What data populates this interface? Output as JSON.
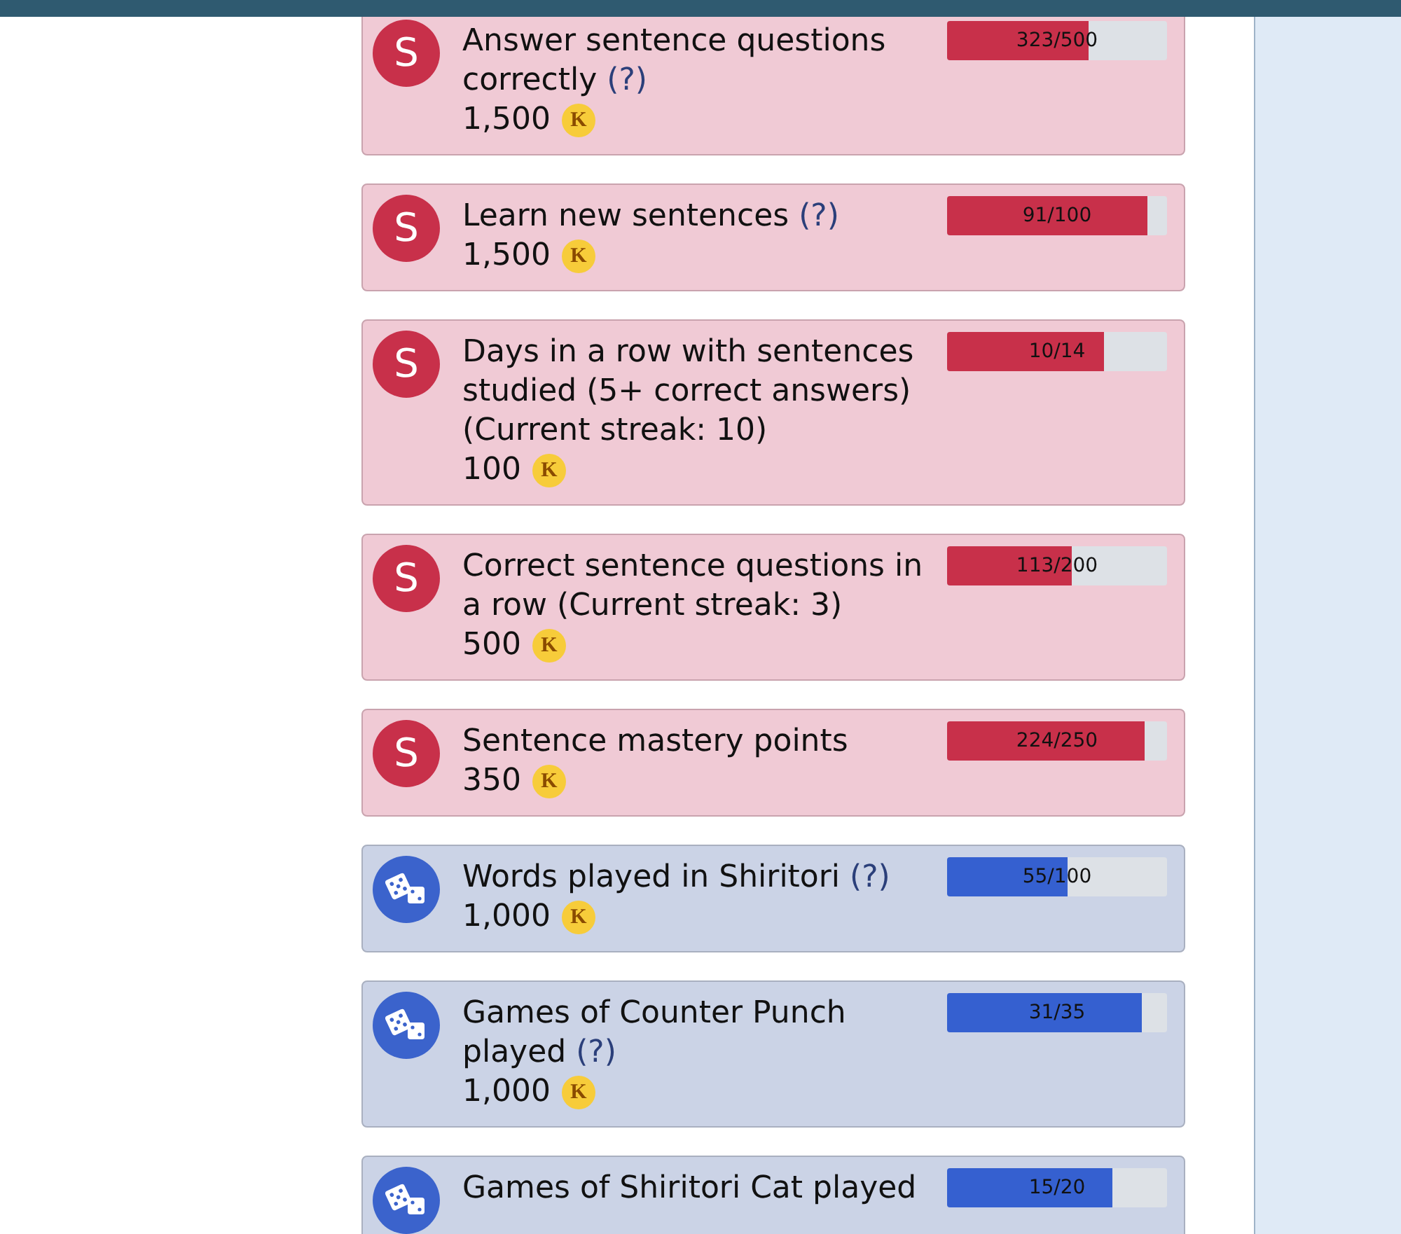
{
  "goals": [
    {
      "kind": "sentence",
      "icon_text": "S",
      "title": "Answer sentence questions correctly",
      "help": "(?)",
      "reward": "1,500",
      "coin": "K",
      "progress": "323/500",
      "level": 0.646
    },
    {
      "kind": "sentence",
      "icon_text": "S",
      "title": "Learn new sentences",
      "help": "(?)",
      "reward": "1,500",
      "coin": "K",
      "progress": "91/100",
      "level": 0.91
    },
    {
      "kind": "sentence",
      "icon_text": "S",
      "title": "Days in a row with sentences studied (5+ correct answers) (Current streak: 10)",
      "reward": "100",
      "coin": "K",
      "progress": "10/14",
      "level": 0.714
    },
    {
      "kind": "sentence",
      "icon_text": "S",
      "title": "Correct sentence questions in a row (Current streak: 3)",
      "reward": "500",
      "coin": "K",
      "progress": "113/200",
      "level": 0.565
    },
    {
      "kind": "sentence",
      "icon_text": "S",
      "title": "Sentence mastery points",
      "reward": "350",
      "coin": "K",
      "progress": "224/250",
      "level": 0.896
    },
    {
      "kind": "game",
      "title": "Words played in Shiritori",
      "help": "(?)",
      "reward": "1,000",
      "coin": "K",
      "progress": "55/100",
      "level": 0.55
    },
    {
      "kind": "game",
      "title": "Games of Counter Punch played",
      "help": "(?)",
      "reward": "1,000",
      "coin": "K",
      "progress": "31/35",
      "level": 0.886
    },
    {
      "kind": "game",
      "title": "Games of Shiritori Cat played",
      "progress": "15/20",
      "level": 0.75
    }
  ]
}
